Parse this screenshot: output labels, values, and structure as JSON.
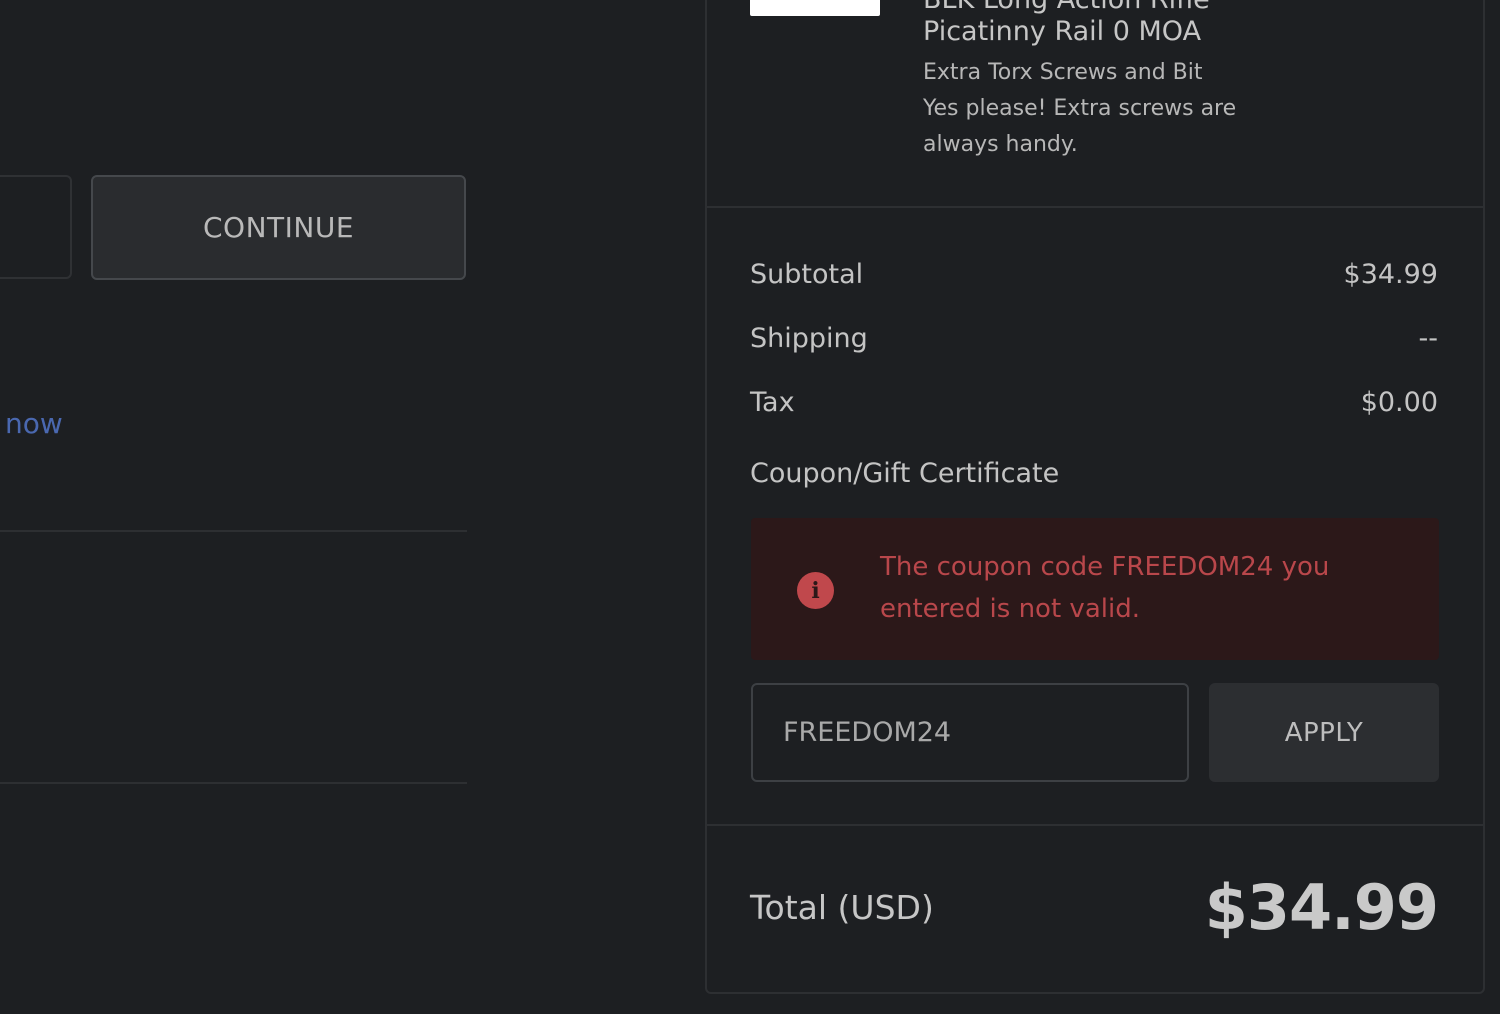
{
  "checkout": {
    "continue_label": "CONTINUE",
    "link_text": "now"
  },
  "cart_item": {
    "title_partial": "BLK Long Action Rifle",
    "title_line2": "Picatinny Rail 0 MOA",
    "option_name": "Extra Torx Screws and Bit",
    "option_value": "Yes please! Extra screws are always handy."
  },
  "summary": {
    "subtotal_label": "Subtotal",
    "subtotal_value": "$34.99",
    "shipping_label": "Shipping",
    "shipping_value": "--",
    "tax_label": "Tax",
    "tax_value": "$0.00",
    "coupon_label": "Coupon/Gift Certificate",
    "coupon_error": "The coupon code FREEDOM24 you entered is not valid.",
    "coupon_input_value": "FREEDOM24",
    "apply_label": "APPLY",
    "total_label": "Total (USD)",
    "total_value": "$34.99"
  },
  "icons": {
    "alert": "info-circle-icon"
  },
  "colors": {
    "page_background": "#1d1f22",
    "error_background": "#2c1819",
    "error_text": "#b9474b",
    "link": "#4a68b0"
  }
}
